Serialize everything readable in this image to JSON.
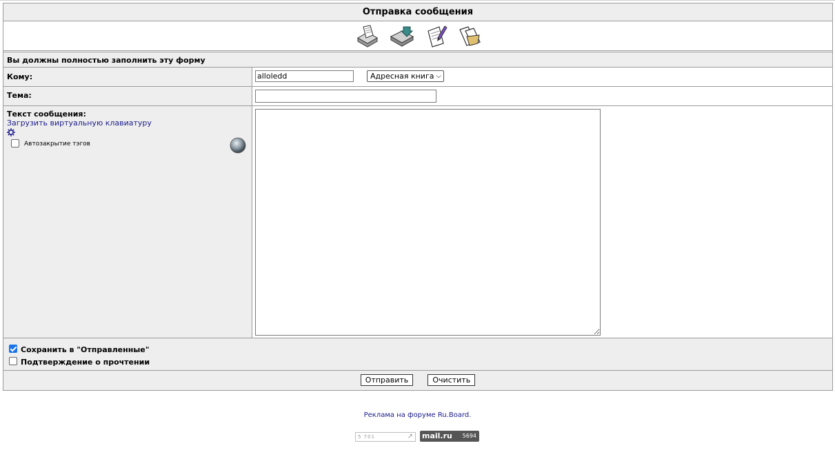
{
  "page": {
    "title": "Отправка сообщения",
    "notice": "Вы должны полностью заполнить эту форму"
  },
  "toolbar": {
    "icons": [
      "inbox-icon",
      "outbox-icon",
      "compose-icon",
      "sent-folder-icon"
    ]
  },
  "form": {
    "to_label": "Кому:",
    "to_value": "alloledd",
    "address_book": "Адресная книга",
    "subject_label": "Тема:",
    "subject_value": "",
    "body_label": "Текст сообщения:",
    "virtual_keyboard_link": "Загрузить виртуальную клавиатуру",
    "autoclose_label": "Автозакрытие тэгов",
    "autoclose_checked": false,
    "body_value": ""
  },
  "options": {
    "save_sent_label": "Сохранить в \"Отправленные\"",
    "save_sent_checked": true,
    "read_receipt_label": "Подтверждение о прочтении",
    "read_receipt_checked": false
  },
  "buttons": {
    "send": "Отправить",
    "clear": "Очистить"
  },
  "footer": {
    "ad_text": "Реклама на форуме Ru.Board.",
    "counter1_text": "5 701",
    "mailru_logo": "mail.ru",
    "mailru_count": "5694"
  },
  "colors": {
    "row_bg": "#eeeeee",
    "border": "#9a9a9a",
    "link": "#1a1a8c",
    "checkbox_accent": "#1a73e8"
  }
}
